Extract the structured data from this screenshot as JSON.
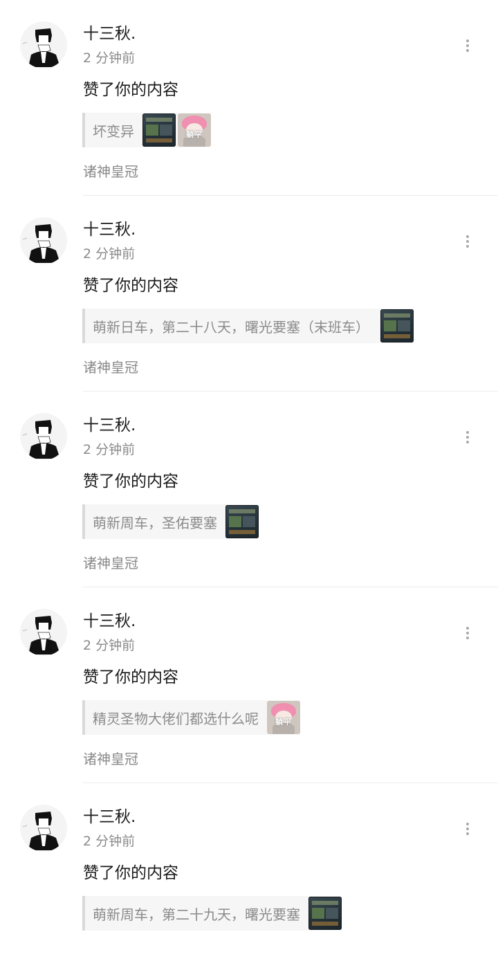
{
  "feed": {
    "items": [
      {
        "username": "十三秋.",
        "time": "2 分钟前",
        "action": "赞了你的内容",
        "quote": "坏变异",
        "thumbs": [
          "game",
          "anime"
        ],
        "thumb_caption": "躺平",
        "source": "诸神皇冠"
      },
      {
        "username": "十三秋.",
        "time": "2 分钟前",
        "action": "赞了你的内容",
        "quote": "萌新日车，第二十八天，曙光要塞（末班车）",
        "thumbs": [
          "game"
        ],
        "source": "诸神皇冠"
      },
      {
        "username": "十三秋.",
        "time": "2 分钟前",
        "action": "赞了你的内容",
        "quote": "萌新周车，圣佑要塞",
        "thumbs": [
          "game"
        ],
        "source": "诸神皇冠"
      },
      {
        "username": "十三秋.",
        "time": "2 分钟前",
        "action": "赞了你的内容",
        "quote": "精灵圣物大佬们都选什么呢",
        "thumbs": [
          "anime"
        ],
        "thumb_caption": "躺平",
        "source": "诸神皇冠"
      },
      {
        "username": "十三秋.",
        "time": "2 分钟前",
        "action": "赞了你的内容",
        "quote": "萌新周车，第二十九天，曙光要塞",
        "thumbs": [
          "game"
        ],
        "source": ""
      }
    ]
  }
}
